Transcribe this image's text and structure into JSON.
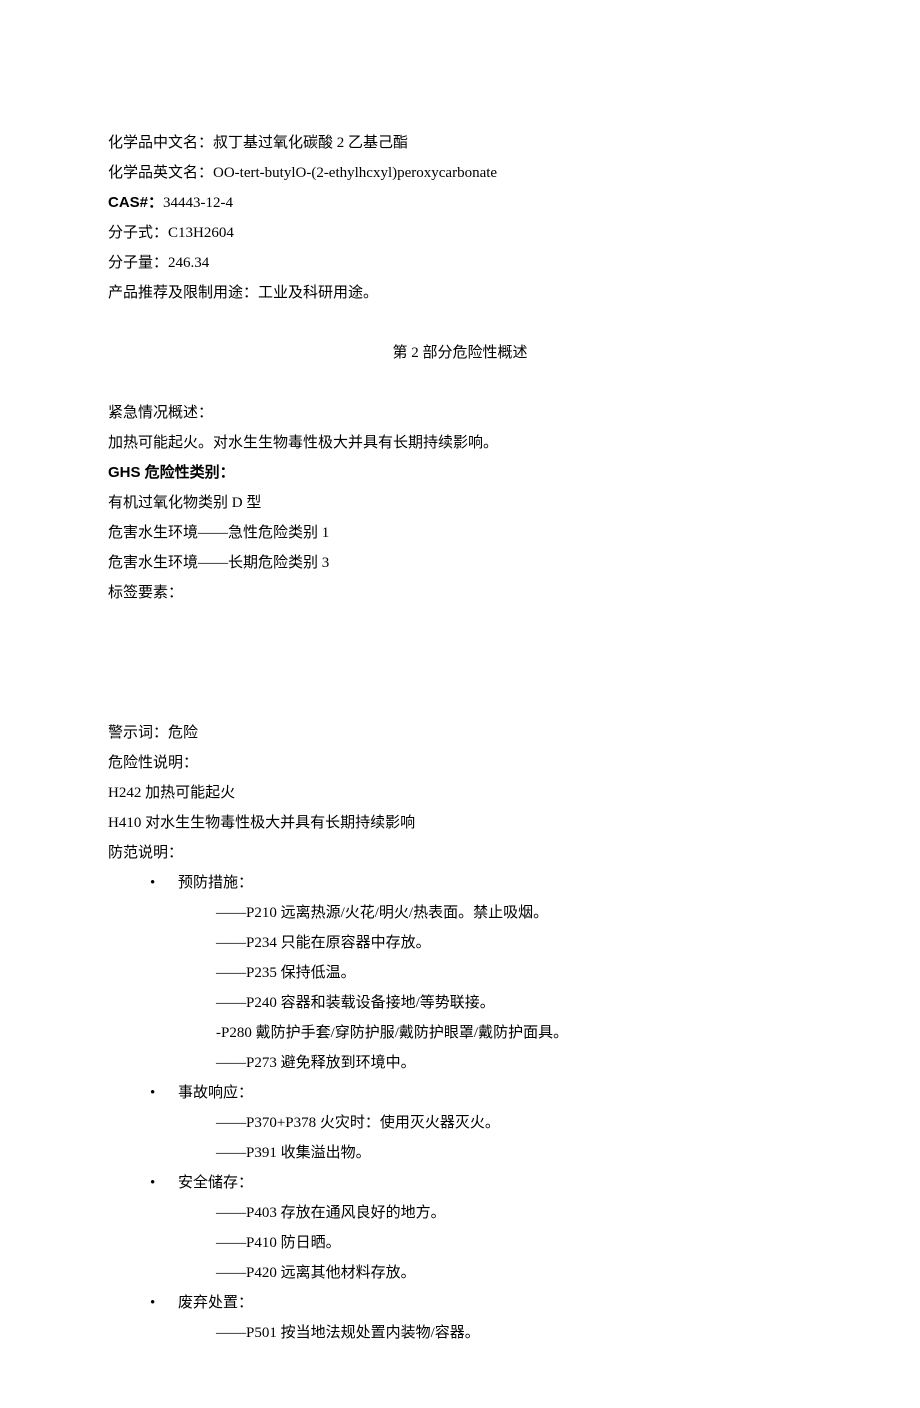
{
  "identification": {
    "name_cn_label": "化学品中文名：",
    "name_cn_value": "叔丁基过氧化碳酸 2 乙基己酯",
    "name_en_label": "化学品英文名：",
    "name_en_value": "OO-tert-butylO-(2-ethylhcxyl)peroxycarbonate",
    "cas_label": "CAS#：",
    "cas_value": "34443-12-4",
    "formula_label": "分子式：",
    "formula_value": "C13H2604",
    "mw_label": "分子量：",
    "mw_value": "246.34",
    "use_label": "产品推荐及限制用途：",
    "use_value": "工业及科研用途。"
  },
  "section2": {
    "header": "第 2 部分危险性概述",
    "emergency_label": "紧急情况概述：",
    "emergency_text": "加热可能起火。对水生生物毒性极大并具有长期持续影响。",
    "ghs_label": "GHS 危险性类别：",
    "ghs_items": [
      "有机过氧化物类别 D 型",
      "危害水生环境——急性危险类别 1",
      "危害水生环境——长期危险类别 3"
    ],
    "label_elements": "标签要素：",
    "signal_label": "警示词：",
    "signal_value": "危险",
    "hazard_label": "危险性说明：",
    "hazard_items": [
      "H242 加热可能起火",
      "H410 对水生生物毒性极大并具有长期持续影响"
    ],
    "precaution_label": "防范说明：",
    "precaution_groups": [
      {
        "title": "预防措施：",
        "items": [
          "——P210 远离热源/火花/明火/热表面。禁止吸烟。",
          "——P234 只能在原容器中存放。",
          "——P235 保持低温。",
          "——P240 容器和装载设备接地/等势联接。",
          "   -P280 戴防护手套/穿防护服/戴防护眼罩/戴防护面具。",
          "——P273 避免释放到环境中。"
        ]
      },
      {
        "title": "事故响应：",
        "items": [
          "——P370+P378 火灾时：使用灭火器灭火。",
          "——P391 收集溢出物。"
        ]
      },
      {
        "title": "安全储存：",
        "items": [
          "——P403 存放在通风良好的地方。",
          "——P410 防日晒。",
          "——P420 远离其他材料存放。"
        ]
      },
      {
        "title": "废弃处置：",
        "items": [
          "——P501 按当地法规处置内装物/容器。"
        ]
      }
    ]
  }
}
